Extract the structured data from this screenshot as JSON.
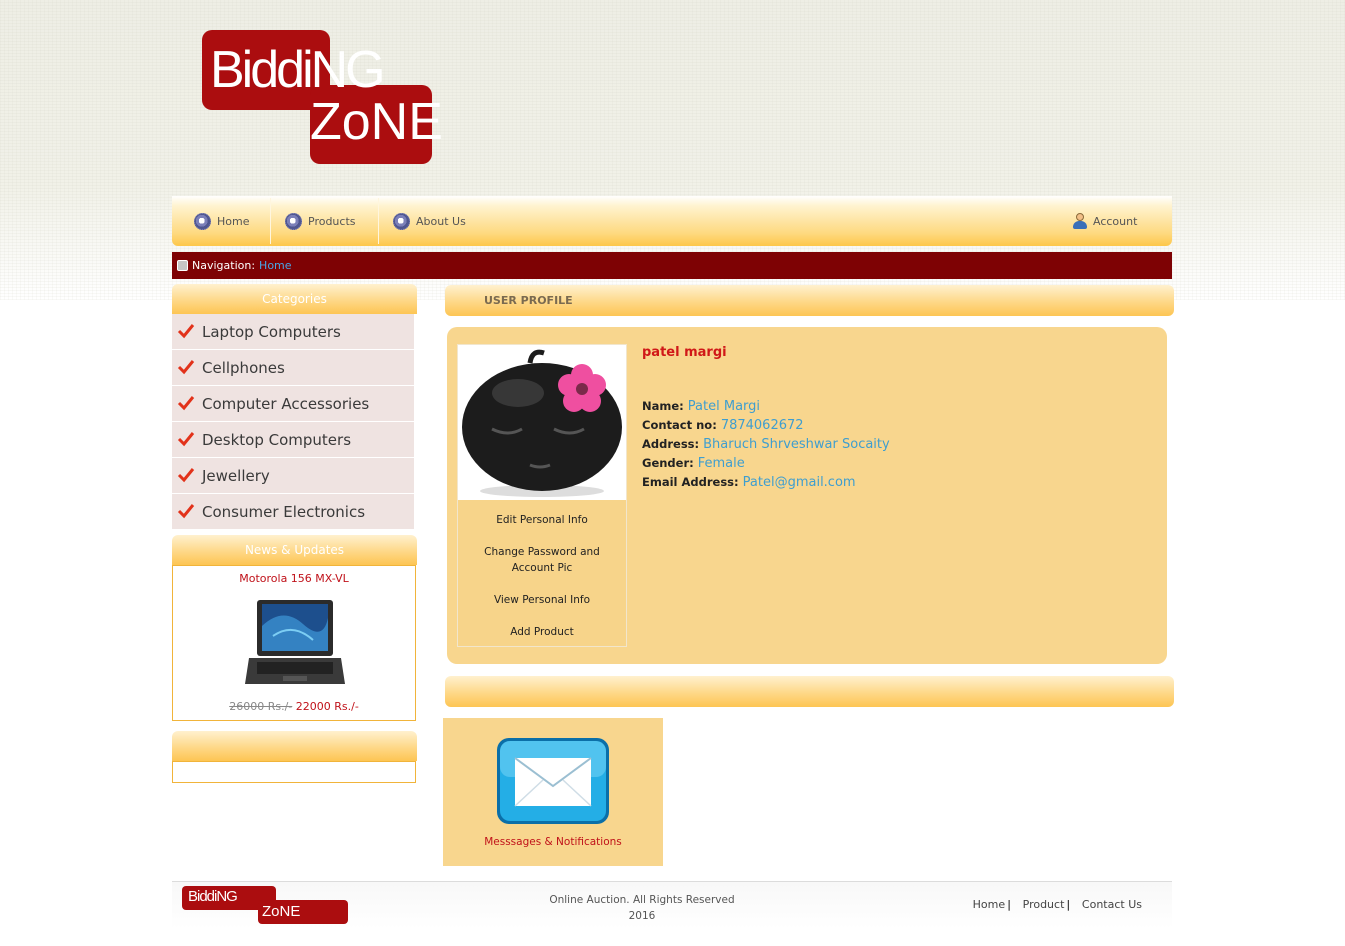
{
  "brand": {
    "logo_line1": "BiddiNG",
    "logo_line2": "ZoNE",
    "colors": {
      "primary": "#ab0d0f",
      "nav_gold": "#fdc74a",
      "breadcrumb": "#7e0204",
      "link": "#3f9ecf"
    }
  },
  "topnav": {
    "items": [
      {
        "label": "Home",
        "icon": "gear-icon"
      },
      {
        "label": "Products",
        "icon": "gear-icon"
      },
      {
        "label": "About Us",
        "icon": "gear-icon"
      }
    ],
    "account": {
      "label": "Account",
      "icon": "user-icon"
    }
  },
  "breadcrumb": {
    "prefix": "Navigation:",
    "current": "Home"
  },
  "sidebar": {
    "categories_title": "Categories",
    "categories": [
      "Laptop Computers",
      "Cellphones",
      "Computer Accessories",
      "Desktop Computers",
      "Jewellery",
      "Consumer Electronics"
    ],
    "news_title": "News & Updates",
    "news_item": {
      "title": "Motorola 156 MX-VL",
      "old_price": "26000 Rs./-",
      "new_price": "22000 Rs./-",
      "image": "laptop-image"
    }
  },
  "profile": {
    "section_title": "USER PROFILE",
    "display_name": "patel margi",
    "fields": [
      {
        "label": "Name:",
        "value": "Patel Margi"
      },
      {
        "label": "Contact no:",
        "value": "7874062672"
      },
      {
        "label": "Address:",
        "value": "Bharuch Shrveshwar Socaity"
      },
      {
        "label": "Gender:",
        "value": "Female"
      },
      {
        "label": "Email Address:",
        "value": "Patel@gmail.com"
      }
    ],
    "menu": [
      "Edit Personal Info",
      "Change Password and Account Pic",
      "View Personal Info",
      "Add Product"
    ]
  },
  "messages": {
    "label": "Messsages & Notifications",
    "icon": "envelope-icon"
  },
  "footer": {
    "copyright_line1": "Online Auction. All Rights Reserved",
    "copyright_line2": "2016",
    "links": [
      "Home",
      "Product",
      "Contact Us"
    ],
    "separator": "|"
  }
}
